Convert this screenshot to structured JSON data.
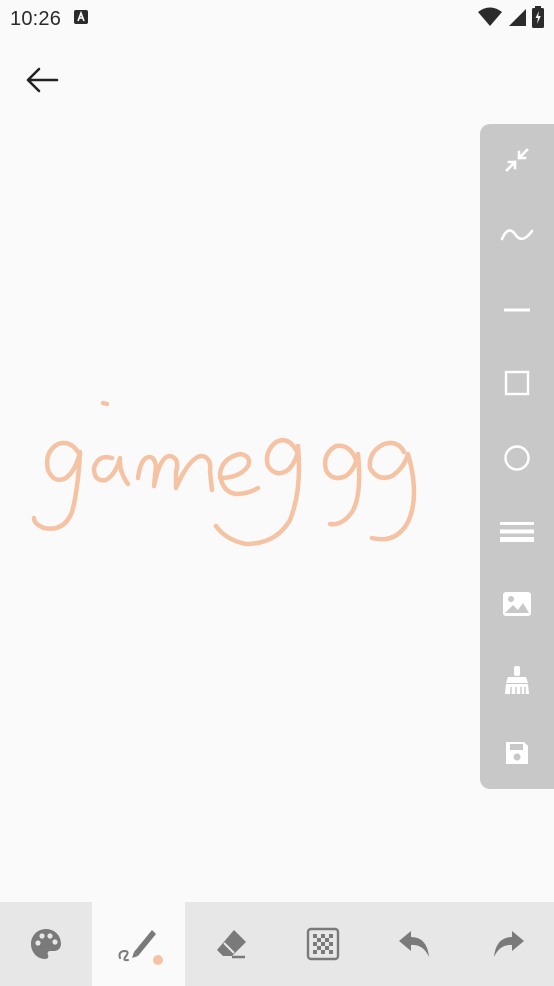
{
  "status_bar": {
    "time": "10:26",
    "notification_icon": "a-notification-icon",
    "wifi_icon": "wifi-icon",
    "signal_icon": "cellular-signal-icon",
    "battery_icon": "battery-charging-icon"
  },
  "header": {
    "back_icon": "arrow-left-icon"
  },
  "right_toolbar": {
    "items": [
      {
        "icon": "collapse-icon"
      },
      {
        "icon": "freehand-curve-icon"
      },
      {
        "icon": "line-icon"
      },
      {
        "icon": "rectangle-icon"
      },
      {
        "icon": "circle-icon"
      },
      {
        "icon": "line-width-icon"
      },
      {
        "icon": "image-icon"
      },
      {
        "icon": "clear-broom-icon"
      },
      {
        "icon": "save-icon"
      }
    ]
  },
  "canvas": {
    "stroke_color": "#f5c3a3",
    "handwriting_text": "gameggg"
  },
  "bottom_toolbar": {
    "items": [
      {
        "icon": "palette-icon",
        "active": false
      },
      {
        "icon": "brush-icon",
        "active": true,
        "indicator_color": "#f5c3a3"
      },
      {
        "icon": "eraser-icon",
        "active": false
      },
      {
        "icon": "mosaic-icon",
        "active": false
      },
      {
        "icon": "undo-icon",
        "active": false
      },
      {
        "icon": "redo-icon",
        "active": false
      }
    ]
  }
}
